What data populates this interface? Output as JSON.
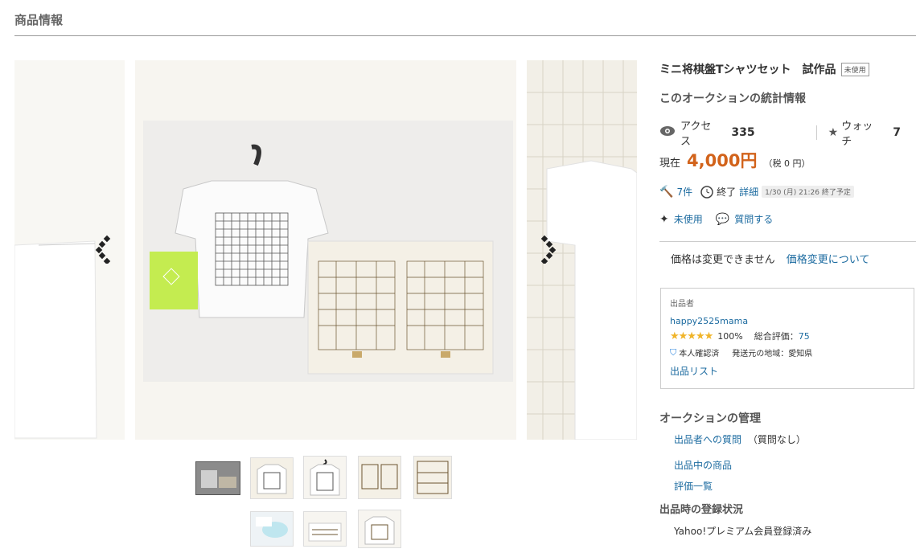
{
  "header": {
    "title": "商品情報"
  },
  "product": {
    "title": "ミニ将棋盤Tシャツセット　試作品",
    "condition_badge": "未使用"
  },
  "stats": {
    "heading": "このオークションの統計情報",
    "access_label": "アクセス",
    "access_count": "335",
    "watch_label": "ウォッチ",
    "watch_count": "7"
  },
  "price": {
    "label": "現在",
    "amount": "4,000円",
    "tax": "（税 0 円）"
  },
  "bids": {
    "count": "7件",
    "end_label": "終了",
    "detail_link": "詳細",
    "end_time": "1/30 (月) 21:26 終了予定"
  },
  "condition_link": "未使用",
  "question_link": "質問する",
  "price_change": {
    "notice": "価格は変更できません",
    "link": "価格変更について"
  },
  "seller": {
    "label": "出品者",
    "name": "happy2525mama",
    "rating_percent": "100%",
    "total_label": "総合評価：",
    "total_score": "75",
    "verified": "本人確認済",
    "ship_from": "発送元の地域：愛知県",
    "listings_link": "出品リスト"
  },
  "management": {
    "heading": "オークションの管理",
    "question_link": "出品者への質問",
    "question_note": "（質問なし）",
    "listing_link": "出品中の商品",
    "reviews_link": "評価一覧"
  },
  "registration": {
    "heading": "出品時の登録状況",
    "value": "Yahoo!プレミアム会員登録済み"
  },
  "colors": {
    "price": "#d2631b",
    "link": "#1c6ba0",
    "star": "#f0b429"
  }
}
